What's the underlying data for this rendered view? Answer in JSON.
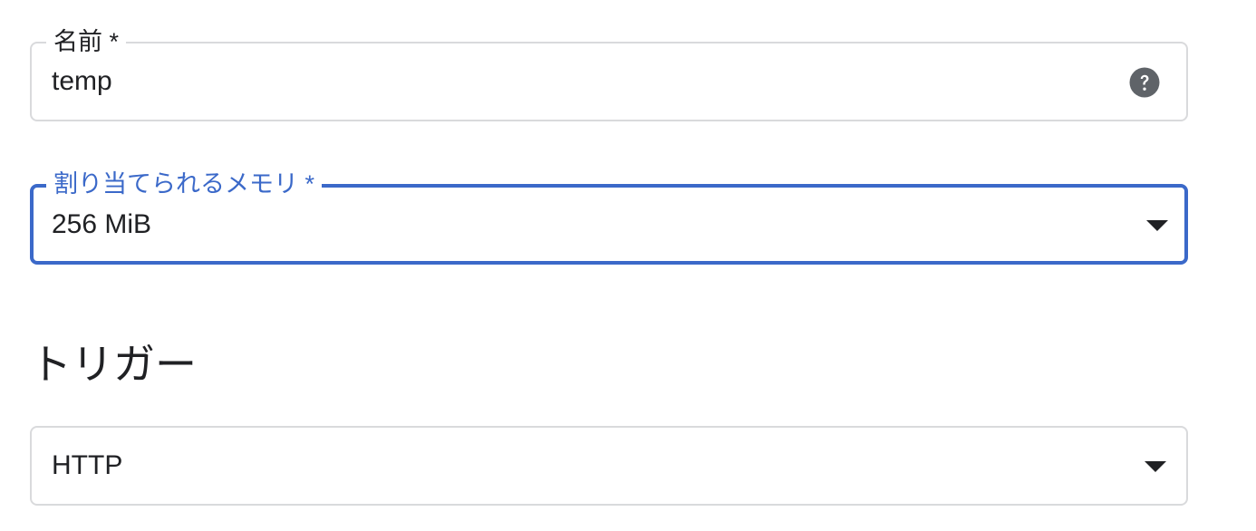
{
  "name_field": {
    "label": "名前 *",
    "value": "temp",
    "help_icon": "help-circle-icon"
  },
  "memory_field": {
    "label": "割り当てられるメモリ *",
    "value": "256 MiB",
    "dropdown_icon": "arrow-drop-down-icon",
    "focus_color": "#3b69c9"
  },
  "trigger_section": {
    "heading": "トリガー"
  },
  "trigger_field": {
    "value": "HTTP",
    "dropdown_icon": "arrow-drop-down-icon"
  }
}
